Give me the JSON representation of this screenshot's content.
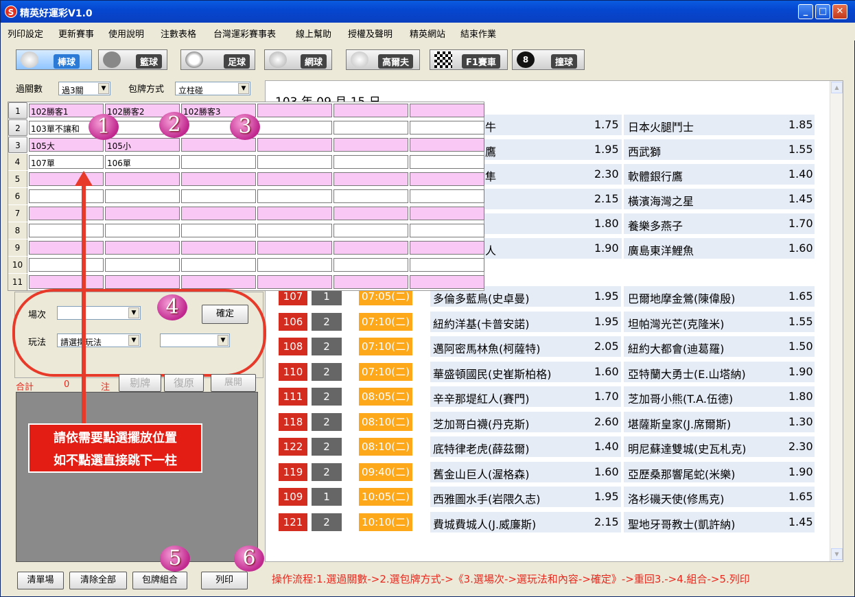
{
  "window": {
    "title": "精英好運彩V1.0",
    "app_icon": "S"
  },
  "menu": [
    "列印設定",
    "更新賽事",
    "使用說明",
    "注數表格",
    "台灣運彩賽事表",
    "線上幫助",
    "授權及聲明",
    "精英網站",
    "結束作業"
  ],
  "sports": [
    "棒球",
    "籃球",
    "足球",
    "網球",
    "高爾夫",
    "F1賽車",
    "撞球"
  ],
  "filters": {
    "pass_label": "過關數",
    "pass_value": "過3關",
    "pack_label": "包牌方式",
    "pack_value": "立柱碰"
  },
  "grid": {
    "row_numbers": [
      "1",
      "2",
      "3",
      "4",
      "5",
      "6",
      "7",
      "8",
      "9",
      "10",
      "11"
    ],
    "rows": [
      [
        "102勝客1",
        "102勝客2",
        "102勝客3",
        "",
        "",
        ""
      ],
      [
        "103單不讓和",
        "",
        "",
        "",
        "",
        ""
      ],
      [
        "105大",
        "105小",
        "",
        "",
        "",
        ""
      ],
      [
        "107單",
        "106單",
        "",
        "",
        "",
        ""
      ],
      [
        "",
        "",
        "",
        "",
        "",
        ""
      ],
      [
        "",
        "",
        "",
        "",
        "",
        ""
      ],
      [
        "",
        "",
        "",
        "",
        "",
        ""
      ],
      [
        "",
        "",
        "",
        "",
        "",
        ""
      ],
      [
        "",
        "",
        "",
        "",
        "",
        ""
      ],
      [
        "",
        "",
        "",
        "",
        "",
        ""
      ],
      [
        "",
        "",
        "",
        "",
        "",
        ""
      ]
    ]
  },
  "badges": [
    "1",
    "2",
    "3",
    "4",
    "5",
    "6"
  ],
  "date_header": "103 年 09 月 15 日",
  "top_games": [
    {
      "home_partial": "牛",
      "odds1": "1.75",
      "away": "日本火腿鬥士",
      "odds2": "1.85"
    },
    {
      "home_partial": "鷹",
      "odds1": "1.95",
      "away": "西武獅",
      "odds2": "1.55"
    },
    {
      "home_partial": "隼",
      "odds1": "2.30",
      "away": "軟體銀行鷹",
      "odds2": "1.40"
    },
    {
      "home_partial": "",
      "odds1": "2.15",
      "away": "橫濱海灣之星",
      "odds2": "1.45"
    },
    {
      "home_partial": "",
      "odds1": "1.80",
      "away": "養樂多燕子",
      "odds2": "1.70"
    },
    {
      "home_partial": "人",
      "odds1": "1.90",
      "away": "廣島東洋鯉魚",
      "odds2": "1.60"
    }
  ],
  "games": [
    {
      "num": "107",
      "g": "1",
      "time": "07:05(二)",
      "home": "多倫多藍鳥(史卓曼)",
      "odds1": "1.95",
      "away": "巴爾地摩金鶯(陳偉殷)",
      "odds2": "1.65"
    },
    {
      "num": "106",
      "g": "2",
      "time": "07:10(二)",
      "home": "紐約洋基(卡普安諾)",
      "odds1": "1.95",
      "away": "坦帕灣光芒(克隆米)",
      "odds2": "1.55"
    },
    {
      "num": "108",
      "g": "2",
      "time": "07:10(二)",
      "home": "邁阿密馬林魚(柯薩特)",
      "odds1": "2.05",
      "away": "紐約大都會(迪葛羅)",
      "odds2": "1.50"
    },
    {
      "num": "110",
      "g": "2",
      "time": "07:10(二)",
      "home": "華盛頓國民(史崔斯柏格)",
      "odds1": "1.60",
      "away": "亞特蘭大勇士(E.山塔納)",
      "odds2": "1.90"
    },
    {
      "num": "111",
      "g": "2",
      "time": "08:05(二)",
      "home": "辛辛那堤紅人(賽門)",
      "odds1": "1.70",
      "away": "芝加哥小熊(T.A.伍德)",
      "odds2": "1.80"
    },
    {
      "num": "118",
      "g": "2",
      "time": "08:10(二)",
      "home": "芝加哥白襪(丹克斯)",
      "odds1": "2.60",
      "away": "堪薩斯皇家(J.席爾斯)",
      "odds2": "1.30"
    },
    {
      "num": "122",
      "g": "2",
      "time": "08:10(二)",
      "home": "底特律老虎(薛茲爾)",
      "odds1": "1.40",
      "away": "明尼蘇達雙城(史瓦札克)",
      "odds2": "2.30"
    },
    {
      "num": "119",
      "g": "2",
      "time": "09:40(二)",
      "home": "舊金山巨人(渥格森)",
      "odds1": "1.60",
      "away": "亞歷桑那響尾蛇(米樂)",
      "odds2": "1.90"
    },
    {
      "num": "109",
      "g": "1",
      "time": "10:05(二)",
      "home": "西雅圖水手(岩隈久志)",
      "odds1": "1.95",
      "away": "洛杉磯天使(修馬克)",
      "odds2": "1.65"
    },
    {
      "num": "121",
      "g": "2",
      "time": "10:10(二)",
      "home": "費城費城人(J.威廉斯)",
      "odds1": "2.15",
      "away": "聖地牙哥教士(凱許納)",
      "odds2": "1.45"
    }
  ],
  "selector": {
    "game_label": "場次",
    "play_label": "玩法",
    "play_value": "請選擇玩法",
    "confirm": "確定"
  },
  "summary": {
    "total_label": "合計",
    "count": "0",
    "unit": "注",
    "remove": "剔牌",
    "restore": "復原",
    "expand": "展開"
  },
  "note": [
    "請依需要點選擺放位置",
    "如不點選直接跳下一柱"
  ],
  "bottom_buttons": [
    "清單場",
    "清除全部",
    "包牌組合",
    "列印"
  ],
  "flow": "操作流程:1.選過關數->2.選包牌方式->《3.選場次->選玩法和內容->確定》->重回3.->4.組合->5.列印",
  "colors": {
    "title_bar": "#0a5ce0",
    "highlight": "#fac8f5",
    "red": "#d42d1f",
    "orange": "#fda81b",
    "badge": "#c0288e"
  }
}
